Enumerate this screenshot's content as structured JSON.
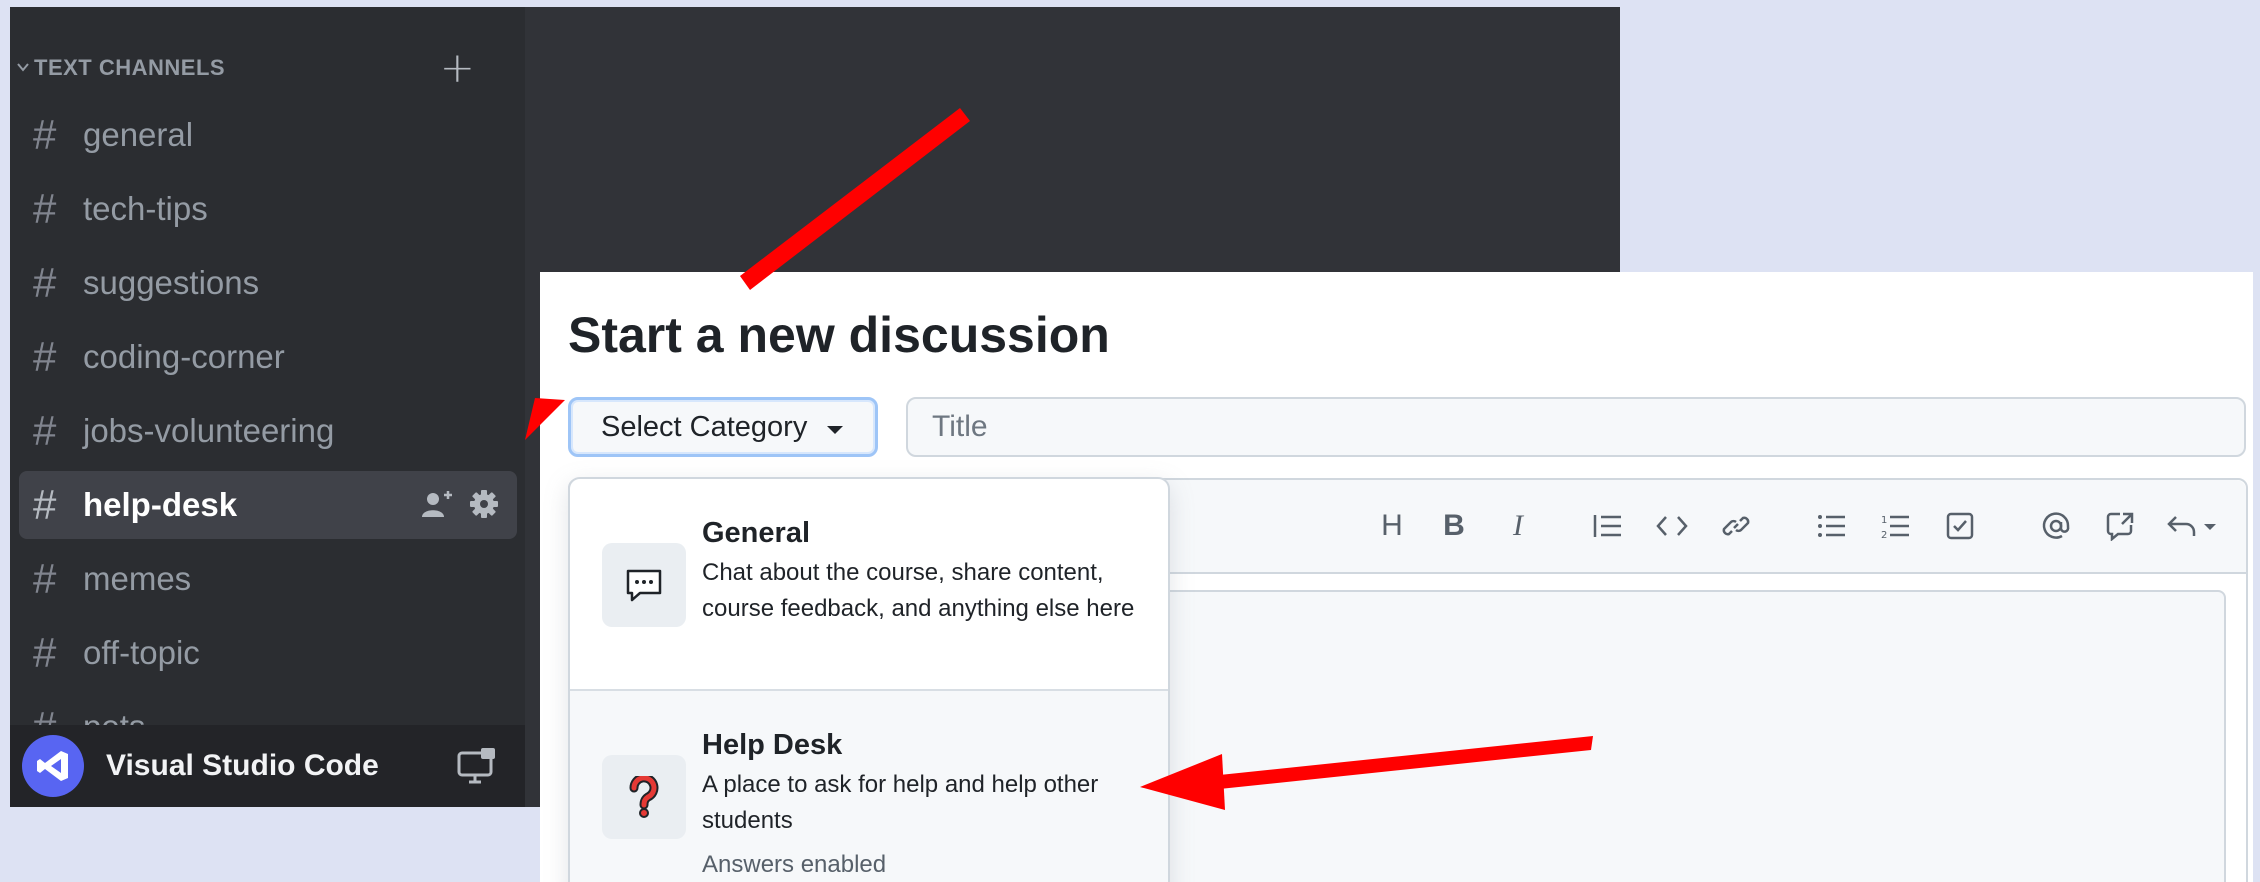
{
  "discord": {
    "category_label": "TEXT CHANNELS",
    "channels": [
      {
        "name": "general"
      },
      {
        "name": "tech-tips"
      },
      {
        "name": "suggestions"
      },
      {
        "name": "coding-corner"
      },
      {
        "name": "jobs-volunteering"
      },
      {
        "name": "help-desk",
        "active": true
      },
      {
        "name": "memes"
      },
      {
        "name": "off-topic"
      },
      {
        "name": "pets"
      }
    ],
    "hash_symbol": "#",
    "app_name": "Visual Studio Code",
    "icons": {
      "collapse": "chevron-down-icon",
      "add": "plus-icon",
      "invite": "add-member-icon",
      "settings": "gear-icon",
      "screen_share": "screen-share-icon"
    }
  },
  "discussion": {
    "heading": "Start a new discussion",
    "category_select_label": "Select Category",
    "title_placeholder": "Title",
    "toolbar": [
      "heading-icon",
      "bold-icon",
      "italic-icon",
      "quote-icon",
      "code-icon",
      "link-icon",
      "bulleted-list-icon",
      "numbered-list-icon",
      "task-list-icon",
      "mention-icon",
      "cross-reference-icon",
      "reply-icon"
    ],
    "toolbar_heading_glyph": "H",
    "toolbar_bold_glyph": "B",
    "toolbar_italic_glyph": "I",
    "categories": [
      {
        "name": "General",
        "description": "Chat about the course, share content, course feedback, and anything else here",
        "icon": "speech-balloon-icon"
      },
      {
        "name": "Help Desk",
        "description": "A place to ask for help and help other students",
        "note": "Answers enabled",
        "icon": "question-mark-icon"
      }
    ]
  },
  "annotation_color": "#ff0000"
}
